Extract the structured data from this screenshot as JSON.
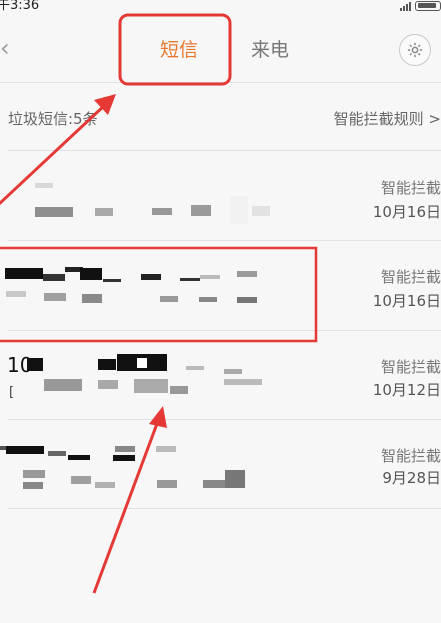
{
  "status": {
    "time": "午3:36"
  },
  "header": {
    "tab_sms": "短信",
    "tab_calls": "来电"
  },
  "spam_bar": {
    "count_label": "垃圾短信:5条",
    "rules_label": "智能拦截规则 >"
  },
  "messages": [
    {
      "tag": "智能拦截",
      "date": "10月16日"
    },
    {
      "tag": "智能拦截",
      "date": "10月16日"
    },
    {
      "sender_prefix": "10",
      "bracket": "[",
      "tag": "智能拦截",
      "date": "10月12日"
    },
    {
      "tag": "智能拦截",
      "date": "9月28日"
    }
  ],
  "colors": {
    "accent": "#e8772e",
    "annotation": "#e53935"
  }
}
